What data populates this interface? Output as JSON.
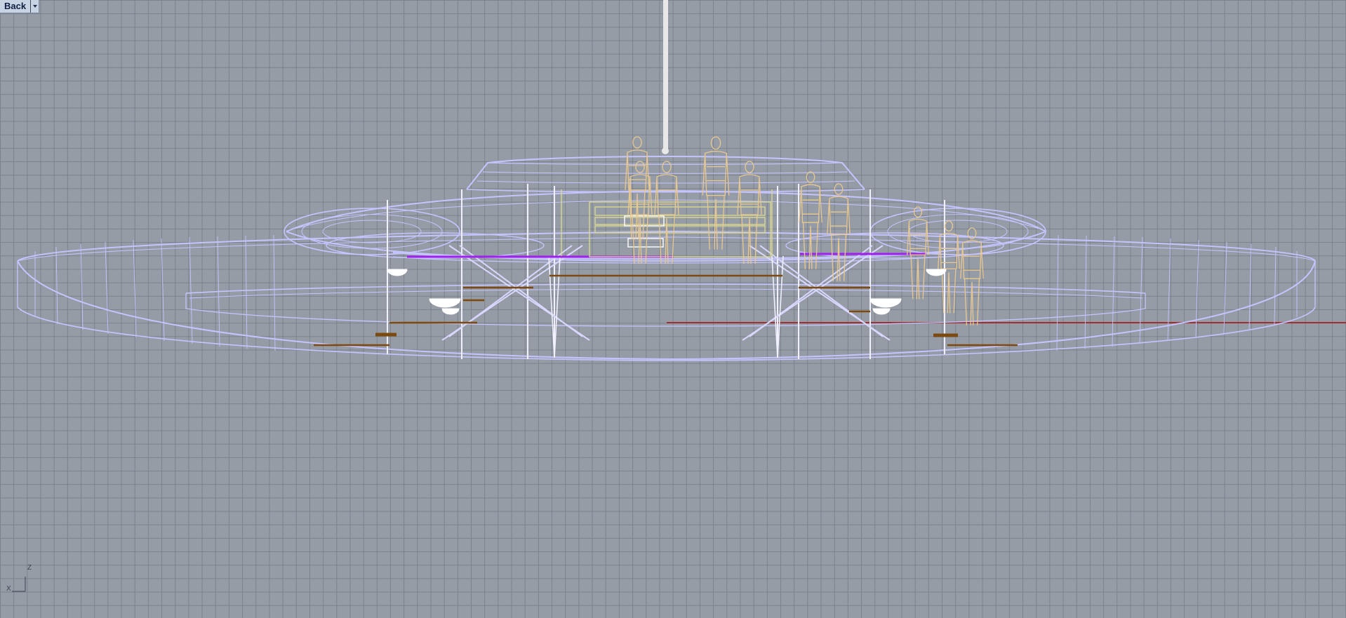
{
  "viewport": {
    "name": "Back",
    "display_mode": "wireframe",
    "colors": {
      "background": "#959ca6",
      "grid": "#787e88",
      "hull": "#c6c4ff",
      "figures": "#e8c890",
      "glass": "#d8d890",
      "accent": "#a020f0",
      "bars": "#7a4a10",
      "x_axis": "#a03030",
      "rod": "#e8e8e8"
    }
  },
  "axis_widget": {
    "x_label": "X",
    "z_label": "Z"
  }
}
